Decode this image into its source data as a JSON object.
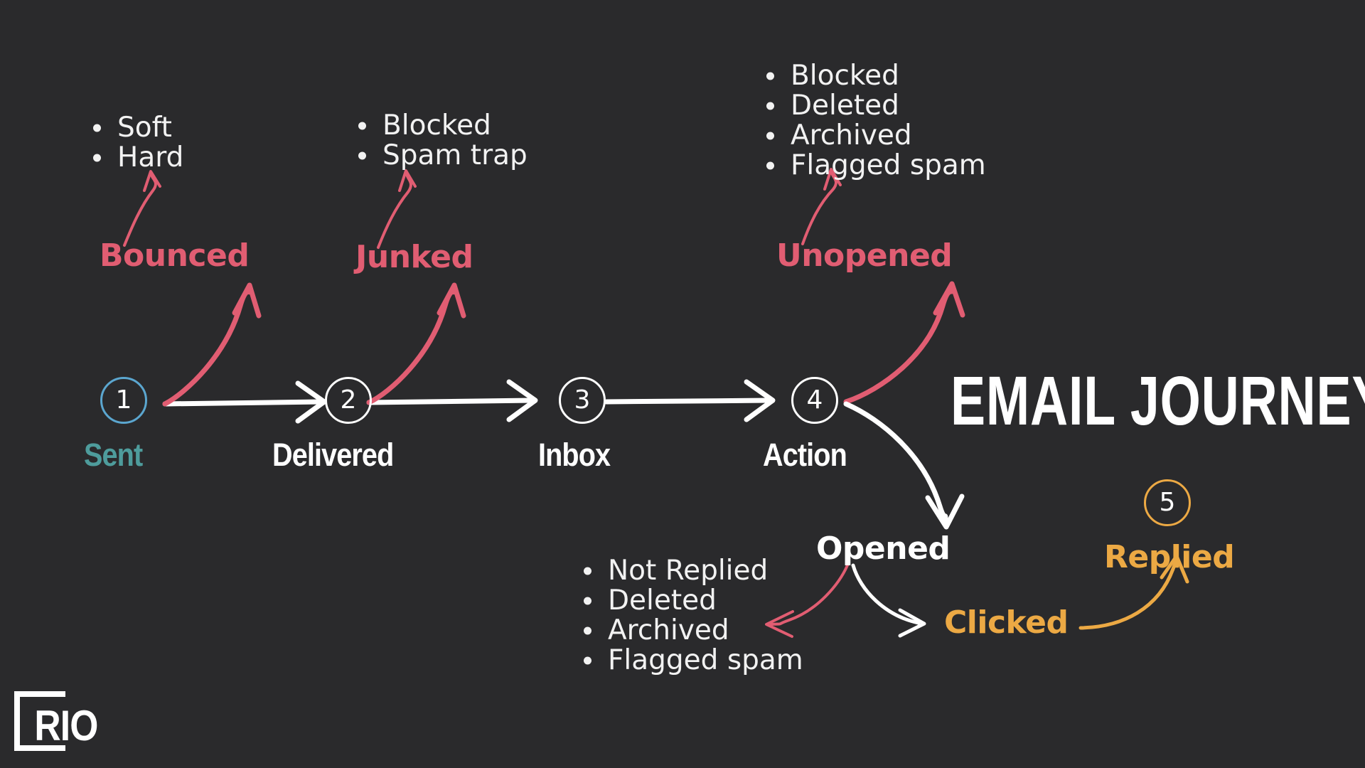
{
  "meta": {
    "background_color": "#2a2a2c",
    "title": "EMAIL JOURNEY"
  },
  "colors": {
    "pink": "#e15d72",
    "orange": "#eca944",
    "teal": "#4e9c9c",
    "blue": "#5ba6cf",
    "white": "#ffffff",
    "background": "#2a2a2c"
  },
  "title": "EMAIL JOURNEY",
  "logo": {
    "text": "RIO"
  },
  "nodes": [
    {
      "number": "1",
      "label": "Sent",
      "accent": "blue"
    },
    {
      "number": "2",
      "label": "Delivered",
      "accent": "white"
    },
    {
      "number": "3",
      "label": "Inbox",
      "accent": "white"
    },
    {
      "number": "4",
      "label": "Action",
      "accent": "white"
    },
    {
      "number": "5",
      "label": "Replied",
      "accent": "gold"
    }
  ],
  "branches": [
    {
      "name": "bounced",
      "label": "Bounced",
      "color": "#e15d72",
      "from": "Sent",
      "items": [
        "Soft",
        "Hard"
      ]
    },
    {
      "name": "junked",
      "label": "Junked",
      "color": "#e15d72",
      "from": "Delivered",
      "items": [
        "Blocked",
        "Spam trap"
      ]
    },
    {
      "name": "unopened",
      "label": "Unopened",
      "color": "#e15d72",
      "from": "Action",
      "items": [
        "Blocked",
        "Deleted",
        "Archived",
        "Flagged spam"
      ]
    },
    {
      "name": "opened",
      "label": "Opened",
      "color": "#ffffff",
      "from": "Action",
      "items": [
        "Not Replied",
        "Deleted",
        "Archived",
        "Flagged spam"
      ]
    },
    {
      "name": "clicked",
      "label": "Clicked",
      "color": "#eca944",
      "from": "Opened",
      "items": []
    }
  ],
  "lists": {
    "bounced": [
      "Soft",
      "Hard"
    ],
    "junked": [
      "Blocked",
      "Spam trap"
    ],
    "unopened": [
      "Blocked",
      "Deleted",
      "Archived",
      "Flagged spam"
    ],
    "opened": [
      "Not Replied",
      "Deleted",
      "Archived",
      "Flagged spam"
    ]
  },
  "labels": {
    "sent": "Sent",
    "delivered": "Delivered",
    "inbox": "Inbox",
    "action": "Action",
    "opened": "Opened",
    "clicked": "Clicked",
    "replied": "Replied",
    "bounced": "Bounced",
    "junked": "Junked",
    "unopened": "Unopened"
  },
  "numbers": {
    "n1": "1",
    "n2": "2",
    "n3": "3",
    "n4": "4",
    "n5": "5"
  }
}
